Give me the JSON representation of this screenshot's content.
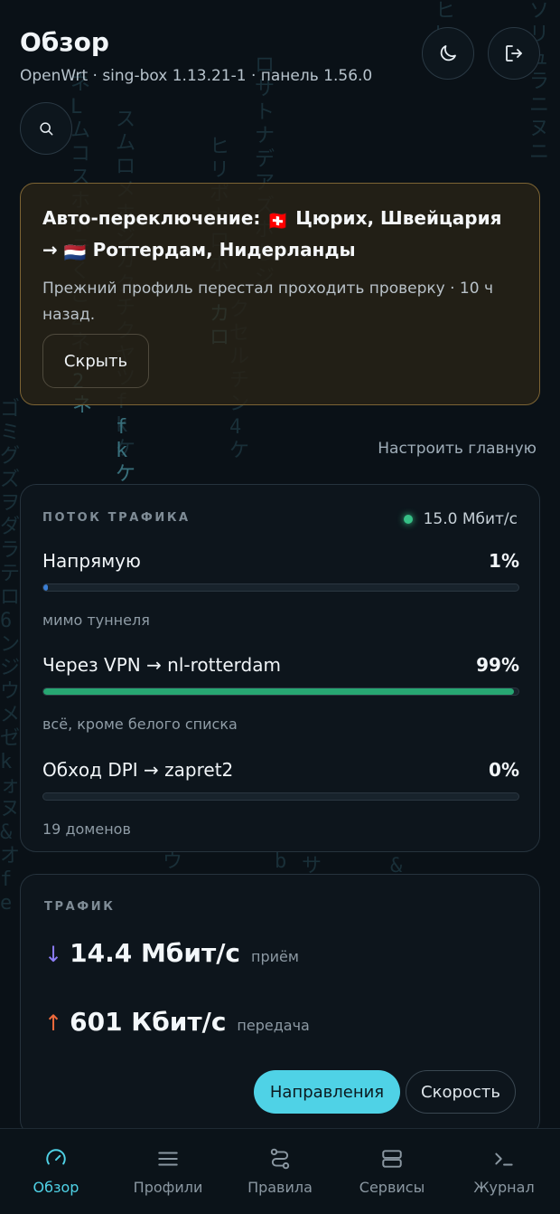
{
  "header": {
    "title": "Обзор",
    "subtitle": "OpenWrt · sing-box 1.13.21-1 · панель 1.56.0"
  },
  "alert": {
    "title_prefix": "Авто-переключение:",
    "from_flag": "🇨🇭",
    "from": "Цюрих, Швейцария",
    "arrow": "→",
    "to_flag": "🇳🇱",
    "to": "Роттердам, Нидерланды",
    "text": "Прежний профиль перестал проходить проверку · 10 ч назад.",
    "hide_label": "Скрыть"
  },
  "customize_label": "Настроить главную",
  "flow": {
    "label": "ПОТОК ТРАФИКА",
    "rate": "15.0 Мбит/с",
    "rows": [
      {
        "name": "Напрямую",
        "pct": "1%",
        "value": 1,
        "note": "мимо туннеля",
        "color": "#3b7fd6"
      },
      {
        "name": "Через VPN → nl-rotterdam",
        "pct": "99%",
        "value": 99,
        "note": "всё, кроме белого списка",
        "color": "#27a672"
      },
      {
        "name": "Обход DPI → zapret2",
        "pct": "0%",
        "value": 0,
        "note": "19 доменов",
        "color": "#d9a441"
      }
    ]
  },
  "traffic": {
    "label": "ТРАФИК",
    "down": {
      "arrow": "↓",
      "value": "14.4 Мбит/с",
      "label": "приём",
      "color": "#8b7cf6"
    },
    "up": {
      "arrow": "↑",
      "value": "601 Кбит/с",
      "label": "передача",
      "color": "#ee6a3c"
    },
    "btn_directions": "Направления",
    "btn_speed": "Скорость"
  },
  "nav": [
    {
      "label": "Обзор",
      "icon": "gauge-icon",
      "active": true
    },
    {
      "label": "Профили",
      "icon": "list-icon",
      "active": false
    },
    {
      "label": "Правила",
      "icon": "route-icon",
      "active": false
    },
    {
      "label": "Сервисы",
      "icon": "server-icon",
      "active": false
    },
    {
      "label": "Журнал",
      "icon": "terminal-icon",
      "active": false
    }
  ],
  "colors": {
    "accent": "#4fd2e6",
    "alert_border": "#7d6434",
    "status_dot": "#36c086"
  }
}
